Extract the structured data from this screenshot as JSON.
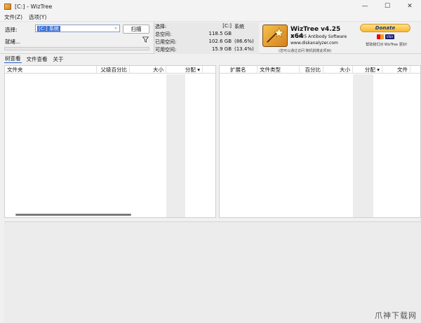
{
  "window": {
    "title": "[C:]  - WizTree",
    "min": "—",
    "max": "☐",
    "close": "✕"
  },
  "menu": [
    "文件(Z)",
    "选项(Y)"
  ],
  "toolbar": {
    "select_label": "选择:",
    "drive_value": "[C:] 系统",
    "scan_label": "扫描",
    "status": "就绪..."
  },
  "stats": {
    "select_label": "选择:",
    "select_drive": "[C:]",
    "select_name": "系统",
    "total_label": "总空间:",
    "total_value": "118.5 GB",
    "used_label": "已用空间:",
    "used_value": "102.6 GB",
    "used_pct": "(86.6%)",
    "free_label": "可用空间:",
    "free_value": "15.9 GB",
    "free_pct": "(13.4%)"
  },
  "logo": {
    "title": "WizTree v4.25 x64",
    "copyright": "© 2025 Antibody Software",
    "url": "www.diskanalyzer.com",
    "note": "(您可以通过访问 随机捐赠此项目)"
  },
  "donate": {
    "label": "Donate",
    "note": "帮助我们对 WizTree 更好!",
    "cards": [
      "MC",
      "VISA"
    ]
  },
  "tabs": [
    "树查看",
    "文件查看",
    "关于"
  ],
  "left_table": {
    "columns": [
      "文件夹",
      "父级百分比",
      "大小",
      "分配 ▾"
    ]
  },
  "right_table": {
    "columns": [
      "扩展名",
      "文件类型",
      "百分比",
      "大小",
      "分配 ▾",
      "文件"
    ]
  },
  "watermark": "爪神下载网",
  "colors": {
    "accent": "#3b6fd4",
    "donate_gold": "#f7b733",
    "logo_orange": "#d47f1e"
  }
}
